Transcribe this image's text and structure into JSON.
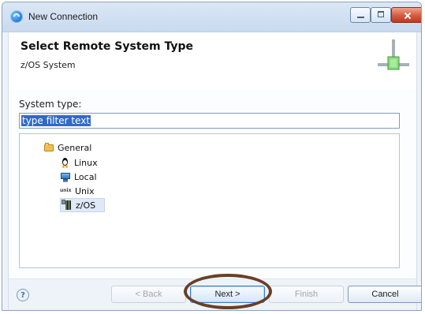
{
  "window": {
    "title": "New Connection",
    "controls": {
      "minimize": "minimize",
      "maximize": "maximize",
      "close": "close"
    }
  },
  "header": {
    "title": "Select Remote System Type",
    "subtitle": "z/OS System",
    "icon": "connector-icon"
  },
  "filter": {
    "label": "System type:",
    "placeholder": "type filter text",
    "value": ""
  },
  "tree": {
    "group_label": "General",
    "items": [
      {
        "label": "Linux",
        "icon": "linux-icon"
      },
      {
        "label": "Local",
        "icon": "monitor-icon"
      },
      {
        "label": "Unix",
        "icon": "unix-icon",
        "icon_text": "Unix"
      },
      {
        "label": "z/OS",
        "icon": "zos-icon",
        "selected": true
      }
    ]
  },
  "buttons": {
    "help": "?",
    "back": "< Back",
    "next": "Next >",
    "finish": "Finish",
    "cancel": "Cancel"
  },
  "colors": {
    "window_blue": "#c9daef",
    "selection_blue": "#316ac5",
    "highlight_ring": "#6a3f25",
    "close_red": "#d35a3f"
  }
}
